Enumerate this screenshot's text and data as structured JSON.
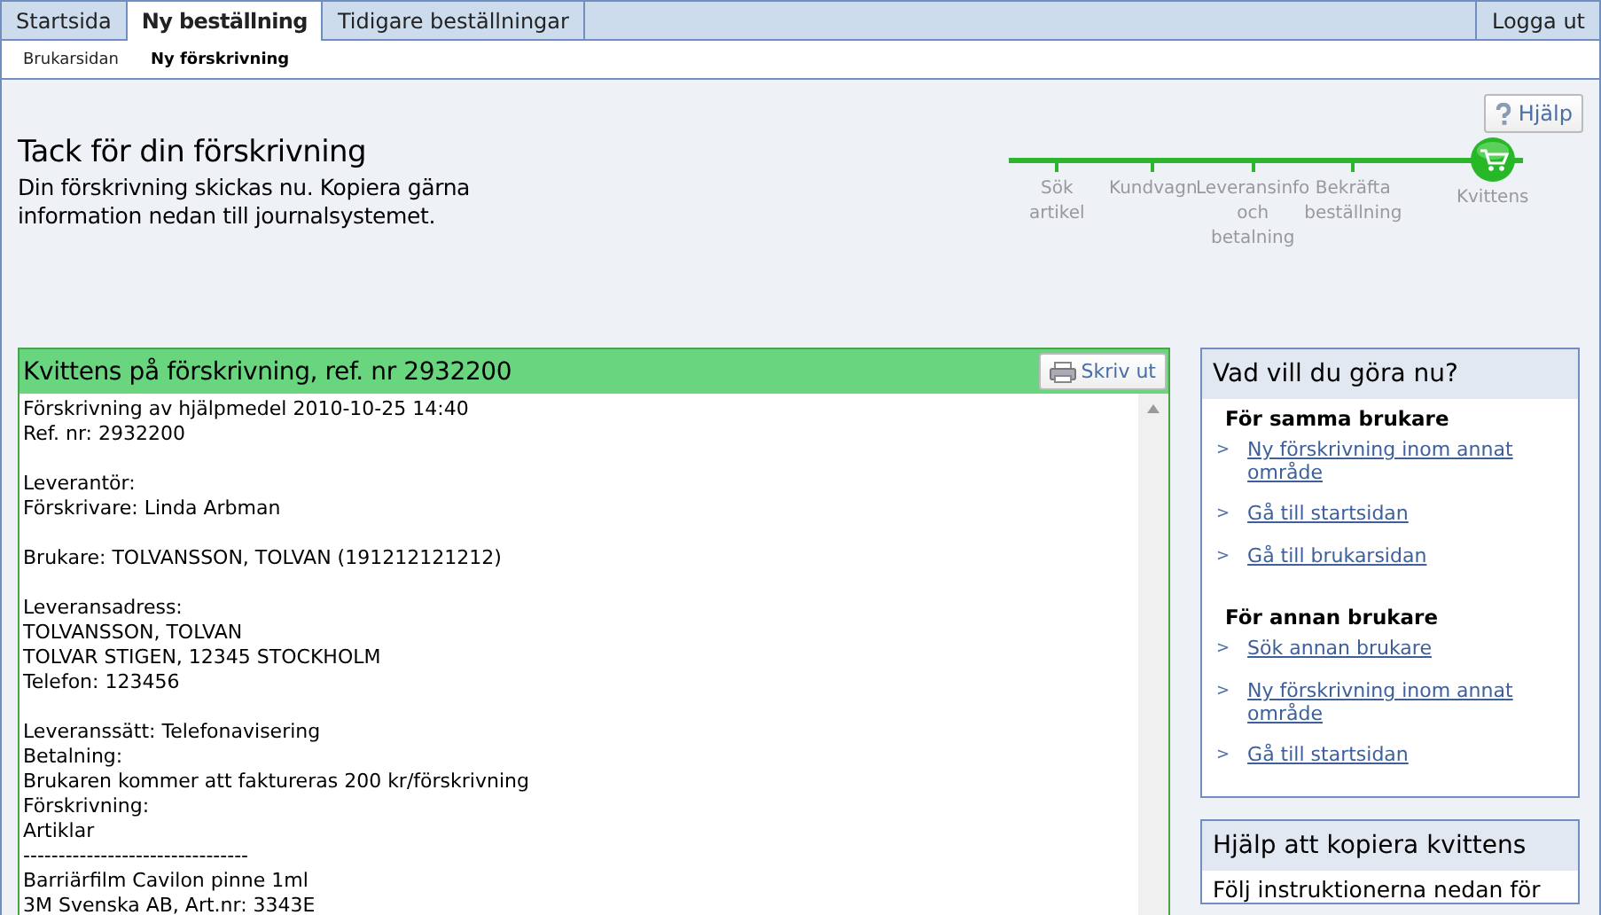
{
  "tabs": [
    {
      "label": "Startsida",
      "selected": false
    },
    {
      "label": "Ny beställning",
      "selected": true
    },
    {
      "label": "Tidigare beställningar",
      "selected": false
    }
  ],
  "logout": "Logga ut",
  "subnav": [
    {
      "label": "Brukarsidan",
      "selected": false
    },
    {
      "label": "Ny förskrivning",
      "selected": true
    }
  ],
  "help_button": "Hjälp",
  "heading": "Tack för din förskrivning",
  "intro": "Din förskrivning skickas nu. Kopiera gärna information nedan till journalsystemet.",
  "steps": [
    {
      "label": "Sök artikel",
      "current": false
    },
    {
      "label": "Kundvagn",
      "current": false
    },
    {
      "label": "Leveransinfo och betalning",
      "current": false
    },
    {
      "label": "Bekräfta beställning",
      "current": false
    },
    {
      "label": "Kvittens",
      "current": true
    }
  ],
  "receipt": {
    "title": "Kvittens på förskrivning, ref. nr 2932200",
    "print_button": "Skriv ut",
    "paragraphs": [
      [
        "Förskrivning av hjälpmedel 2010-10-25 14:40",
        "Ref. nr: 2932200"
      ],
      [
        "Leverantör:",
        "Förskrivare: Linda Arbman"
      ],
      [
        "Brukare: TOLVANSSON, TOLVAN (191212121212)"
      ],
      [
        "Leveransadress:",
        "TOLVANSSON, TOLVAN",
        "TOLVAR STIGEN, 12345 STOCKHOLM",
        "Telefon: 123456"
      ],
      [
        "Leveranssätt: Telefonavisering",
        "Betalning:",
        "Brukaren kommer att faktureras 200 kr/förskrivning",
        "Förskrivning:",
        "Artiklar",
        "--------------------------------",
        "Barriärfilm Cavilon pinne 1ml",
        "3M Svenska AB, Art.nr: 3343E"
      ]
    ]
  },
  "actions": {
    "title": "Vad vill du göra nu?",
    "sections": [
      {
        "heading": "För samma brukare",
        "links": [
          {
            "marker": ">",
            "label": "Ny förskrivning inom annat område"
          },
          {
            "marker": ">",
            "label": "Gå till startsidan"
          },
          {
            "marker": ">",
            "label": "Gå till brukarsidan"
          }
        ]
      },
      {
        "heading": "För annan brukare",
        "links": [
          {
            "marker": ">",
            "label": "Sök annan brukare"
          },
          {
            "marker": ">",
            "label": "Ny förskrivning inom annat område"
          },
          {
            "marker": ">",
            "label": "Gå till startsidan"
          }
        ]
      }
    ]
  },
  "copy_help": {
    "title": "Hjälp att kopiera kvittens",
    "text": "Följ instruktionerna nedan för"
  }
}
